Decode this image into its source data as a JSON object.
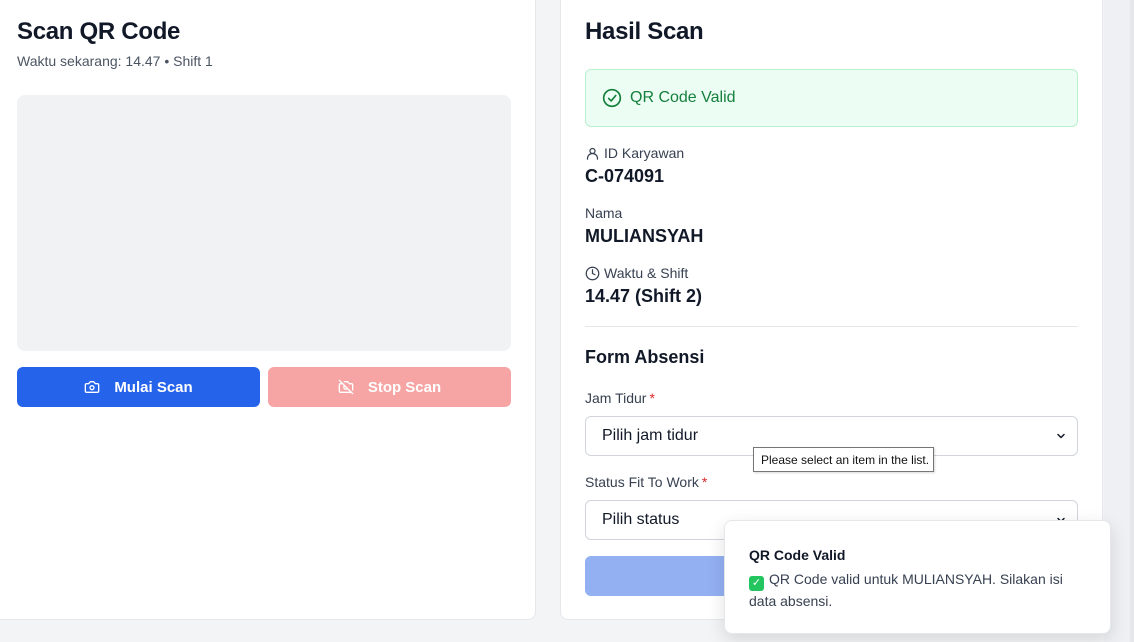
{
  "scanner": {
    "title": "Scan QR Code",
    "subtitle": "Waktu sekarang: 14.47 • Shift 1",
    "start_label": "Mulai Scan",
    "stop_label": "Stop Scan"
  },
  "result": {
    "title": "Hasil Scan",
    "alert": "QR Code Valid",
    "employee_id_label": "ID Karyawan",
    "employee_id": "C-074091",
    "name_label": "Nama",
    "name": "MULIANSYAH",
    "time_label": "Waktu & Shift",
    "time_value": "14.47 (Shift 2)"
  },
  "form": {
    "title": "Form Absensi",
    "sleep_label": "Jam Tidur",
    "sleep_placeholder": "Pilih jam tidur",
    "status_label": "Status Fit To Work",
    "status_placeholder": "Pilih status",
    "required_mark": "*"
  },
  "tooltip": "Please select an item in the list.",
  "toast": {
    "title": "QR Code Valid",
    "body": "QR Code valid untuk MULIANSYAH. Silakan isi data absensi.",
    "icon": "check-mark-button-emoji"
  },
  "colors": {
    "primary": "#2563eb",
    "danger_disabled": "#f6a4a4",
    "success": "#15803d"
  }
}
